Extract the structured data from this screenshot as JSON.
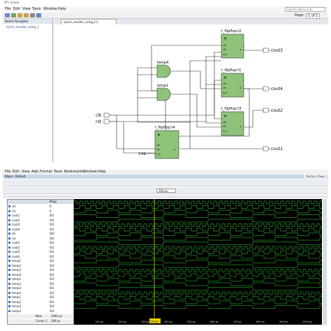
{
  "rtl": {
    "title": "RTL Viewer",
    "search_placeholder": "Search altera.com",
    "menu": [
      "File",
      "Edit",
      "View",
      "Tools",
      "Window",
      "Help"
    ],
    "page_label": "Page:",
    "page_value": "1 of 1",
    "nav_title": "Netlist Navigator",
    "nav_item": "synch_counter_using_1",
    "tab_label": "synch_counter_using_t:1",
    "inputs": [
      "clk",
      "rst"
    ],
    "outputs": [
      "cout3",
      "cout4",
      "cout2",
      "cout1"
    ],
    "blocks": [
      "t_flipflop:t2",
      "t_flipflop:t1",
      "t_flipflop:t3",
      "t_flipflop:t4"
    ],
    "gates": [
      "temp4",
      "temp1"
    ],
    "pins": {
      "clk": "clk",
      "rst": "rst",
      "tin": "t_in",
      "q": "q"
    },
    "const": "1'h1"
  },
  "wave": {
    "menu": [
      "File",
      "Edit",
      "View",
      "Add",
      "Format",
      "Tools",
      "Bookmarks",
      "Window",
      "Help"
    ],
    "window_title": "Wave - Default",
    "restore": "Restore Down",
    "header_msgs": "Msgs",
    "signals": [
      {
        "name": "clk",
        "value": "0"
      },
      {
        "name": "rst",
        "value": "0"
      },
      {
        "name": "cout1",
        "value": "St1"
      },
      {
        "name": "cout2",
        "value": "St1"
      },
      {
        "name": "cout3",
        "value": "St1"
      },
      {
        "name": "cout4",
        "value": "St1"
      },
      {
        "name": "clk",
        "value": "St0"
      },
      {
        "name": "rst",
        "value": "St0"
      },
      {
        "name": "cout1",
        "value": "St1"
      },
      {
        "name": "cout2",
        "value": "St1"
      },
      {
        "name": "cout3",
        "value": "St1"
      },
      {
        "name": "cout4",
        "value": "St1"
      },
      {
        "name": "temp1",
        "value": "St1"
      },
      {
        "name": "temp2",
        "value": "St1"
      },
      {
        "name": "temp3",
        "value": "St1"
      },
      {
        "name": "temp4",
        "value": "St1"
      },
      {
        "name": "temp1",
        "value": "St1"
      },
      {
        "name": "temp2",
        "value": "St1"
      },
      {
        "name": "temp3",
        "value": "St1"
      },
      {
        "name": "temp4",
        "value": "St1"
      },
      {
        "name": "temp1",
        "value": "St1"
      },
      {
        "name": "temp2",
        "value": "St1"
      },
      {
        "name": "temp3",
        "value": "St1"
      },
      {
        "name": "temp4",
        "value": "St1"
      }
    ],
    "now_label": "Now",
    "now_value": "1040 ps",
    "cursor_label": "Cursor 1",
    "cursor_value": "208 ps",
    "cursor_flag": "208 ps",
    "time_ticks": [
      "100 ps",
      "200 ps",
      "300 ps",
      "400 ps",
      "500 ps",
      "600 ps",
      "700 ps",
      "800 ps",
      "900 ps",
      "1000 ps"
    ],
    "zoom_value": "100 ps"
  }
}
